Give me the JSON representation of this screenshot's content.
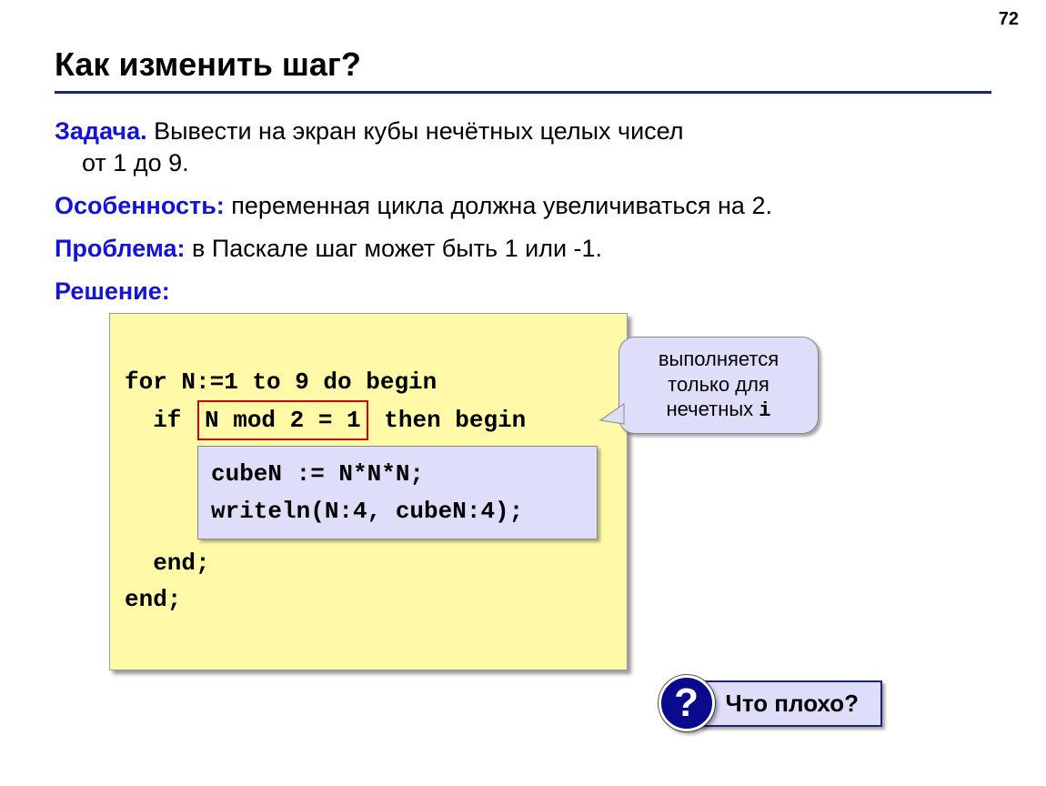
{
  "page_number": "72",
  "title": "Как изменить шаг?",
  "task": {
    "label": "Задача.",
    "text_line1": " Вывести на экран кубы нечётных целых чисел",
    "text_line2": "от 1 до 9."
  },
  "feature": {
    "label": "Особенность:",
    "text": " переменная цикла должна увеличиваться на 2."
  },
  "problem": {
    "label": "Проблема:",
    "text": " в Паскале шаг может быть 1 или -1."
  },
  "solution_label": "Решение:",
  "code": {
    "line1": "for N:=1 to 9 do begin",
    "if_prefix": "  if ",
    "mod_expr": "N mod 2 = 1",
    "if_suffix": " then begin",
    "inner1": "cubeN := N*N*N;",
    "inner2": "writeln(N:4, cubeN:4);",
    "end1": "  end;",
    "end2": "end;"
  },
  "callout": {
    "line1": "выполняется",
    "line2": "только для",
    "line3_prefix": "нечетных ",
    "line3_var": "i"
  },
  "question": {
    "mark": "?",
    "text": "Что плохо?"
  }
}
